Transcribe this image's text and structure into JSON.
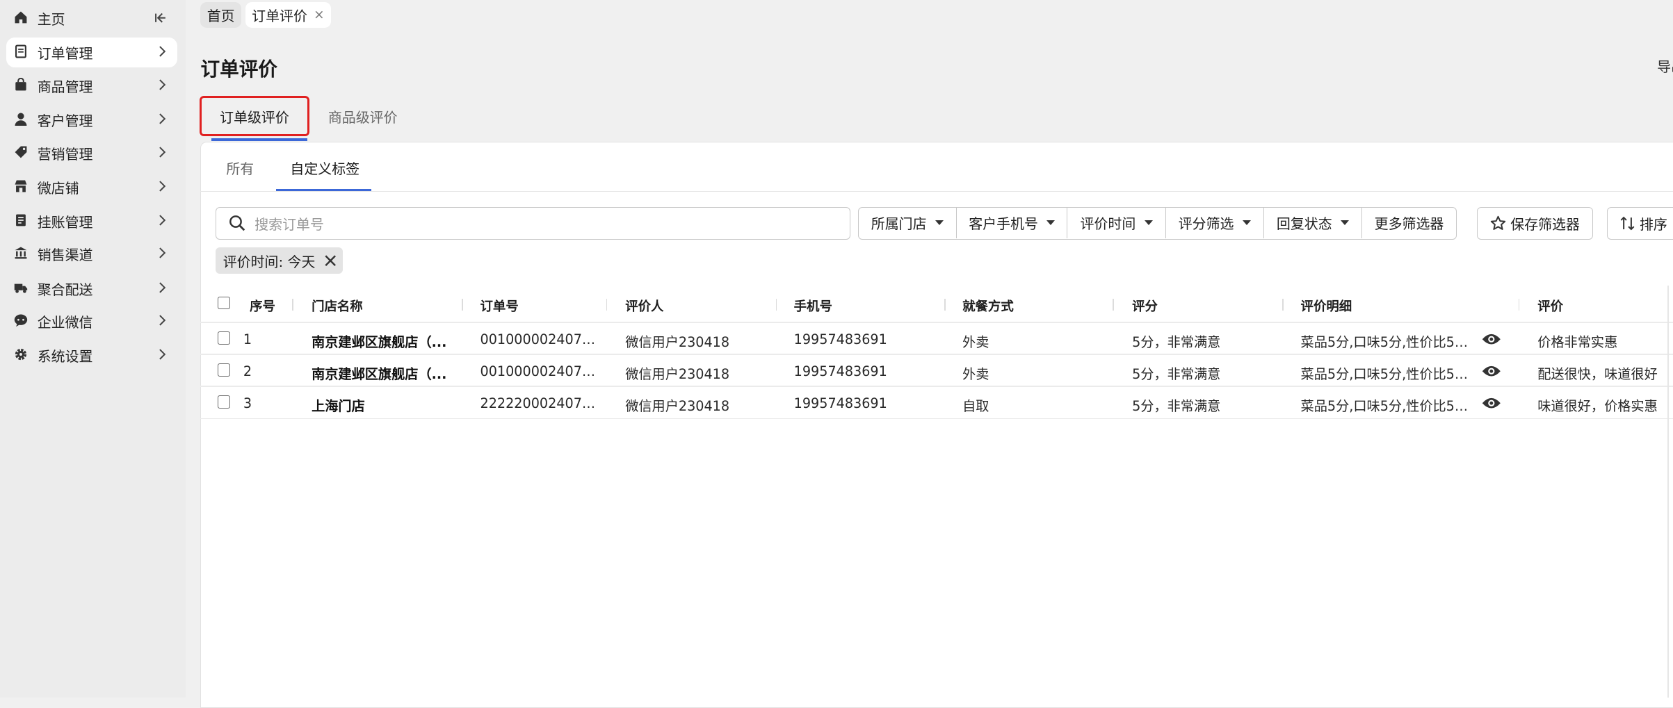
{
  "sidebar": {
    "items": [
      {
        "label": "主页",
        "icon": "home-icon"
      },
      {
        "label": "订单管理",
        "icon": "order-icon"
      },
      {
        "label": "商品管理",
        "icon": "product-bag-icon"
      },
      {
        "label": "客户管理",
        "icon": "person-icon"
      },
      {
        "label": "营销管理",
        "icon": "tag-icon"
      },
      {
        "label": "微店铺",
        "icon": "store-icon"
      },
      {
        "label": "挂账管理",
        "icon": "ledger-icon"
      },
      {
        "label": "销售渠道",
        "icon": "bank-icon"
      },
      {
        "label": "聚合配送",
        "icon": "truck-icon"
      },
      {
        "label": "企业微信",
        "icon": "chat-bubble-icon"
      },
      {
        "label": "系统设置",
        "icon": "gear-icon"
      }
    ],
    "active_index": 1
  },
  "page_tabs": [
    {
      "label": "首页"
    },
    {
      "label": "订单评价",
      "close": "×"
    }
  ],
  "page_title": "订单评价",
  "top_right_text": "导出",
  "level_tabs": [
    "订单级评价",
    "商品级评价"
  ],
  "sub_tabs": [
    "所有",
    "自定义标签"
  ],
  "search": {
    "placeholder": "搜索订单号",
    "value": ""
  },
  "filters": [
    "所属门店",
    "客户手机号",
    "评价时间",
    "评分筛选",
    "回复状态",
    "更多筛选器"
  ],
  "save_filter_label": "保存筛选器",
  "sort_label": "排序",
  "active_filter_chip": "评价时间: 今天",
  "table": {
    "columns": [
      "序号",
      "门店名称",
      "订单号",
      "评价人",
      "手机号",
      "就餐方式",
      "评分",
      "评价明细",
      "评价"
    ],
    "rows": [
      {
        "no": "1",
        "store": "南京建邺区旗舰店（...",
        "order": "00100000240710...",
        "reviewer": "微信用户230418",
        "phone": "19957483691",
        "dining": "外卖",
        "score": "5分，非常满意",
        "detail": "菜品5分,口味5分,性价比5分...",
        "review": "价格非常实惠"
      },
      {
        "no": "2",
        "store": "南京建邺区旗舰店（...",
        "order": "00100000240710...",
        "reviewer": "微信用户230418",
        "phone": "19957483691",
        "dining": "外卖",
        "score": "5分，非常满意",
        "detail": "菜品5分,口味5分,性价比5分...",
        "review": "配送很快，味道很好"
      },
      {
        "no": "3",
        "store": "上海门店",
        "order": "22222000240710...",
        "reviewer": "微信用户230418",
        "phone": "19957483691",
        "dining": "自取",
        "score": "5分，非常满意",
        "detail": "菜品5分,口味5分,性价比5分...",
        "review": "味道很好，价格实惠"
      }
    ]
  },
  "colors": {
    "accent": "#3c68d8",
    "highlight_border": "#e02020",
    "sidebar_bg": "#ececec",
    "page_bg": "#f0f0f0"
  }
}
